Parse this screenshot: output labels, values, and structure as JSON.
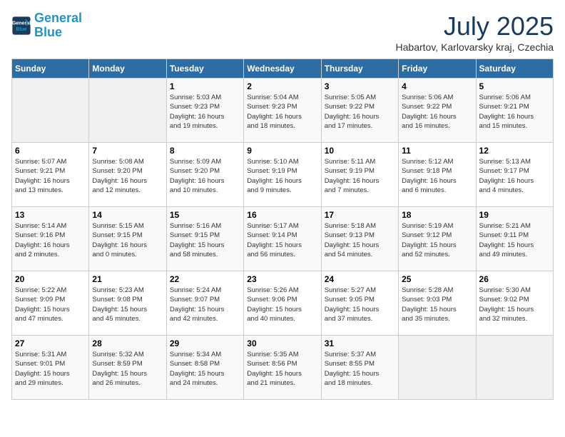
{
  "header": {
    "logo_line1": "General",
    "logo_line2": "Blue",
    "month": "July 2025",
    "location": "Habartov, Karlovarsky kraj, Czechia"
  },
  "weekdays": [
    "Sunday",
    "Monday",
    "Tuesday",
    "Wednesday",
    "Thursday",
    "Friday",
    "Saturday"
  ],
  "weeks": [
    [
      {
        "day": "",
        "detail": ""
      },
      {
        "day": "",
        "detail": ""
      },
      {
        "day": "1",
        "detail": "Sunrise: 5:03 AM\nSunset: 9:23 PM\nDaylight: 16 hours\nand 19 minutes."
      },
      {
        "day": "2",
        "detail": "Sunrise: 5:04 AM\nSunset: 9:23 PM\nDaylight: 16 hours\nand 18 minutes."
      },
      {
        "day": "3",
        "detail": "Sunrise: 5:05 AM\nSunset: 9:22 PM\nDaylight: 16 hours\nand 17 minutes."
      },
      {
        "day": "4",
        "detail": "Sunrise: 5:06 AM\nSunset: 9:22 PM\nDaylight: 16 hours\nand 16 minutes."
      },
      {
        "day": "5",
        "detail": "Sunrise: 5:06 AM\nSunset: 9:21 PM\nDaylight: 16 hours\nand 15 minutes."
      }
    ],
    [
      {
        "day": "6",
        "detail": "Sunrise: 5:07 AM\nSunset: 9:21 PM\nDaylight: 16 hours\nand 13 minutes."
      },
      {
        "day": "7",
        "detail": "Sunrise: 5:08 AM\nSunset: 9:20 PM\nDaylight: 16 hours\nand 12 minutes."
      },
      {
        "day": "8",
        "detail": "Sunrise: 5:09 AM\nSunset: 9:20 PM\nDaylight: 16 hours\nand 10 minutes."
      },
      {
        "day": "9",
        "detail": "Sunrise: 5:10 AM\nSunset: 9:19 PM\nDaylight: 16 hours\nand 9 minutes."
      },
      {
        "day": "10",
        "detail": "Sunrise: 5:11 AM\nSunset: 9:19 PM\nDaylight: 16 hours\nand 7 minutes."
      },
      {
        "day": "11",
        "detail": "Sunrise: 5:12 AM\nSunset: 9:18 PM\nDaylight: 16 hours\nand 6 minutes."
      },
      {
        "day": "12",
        "detail": "Sunrise: 5:13 AM\nSunset: 9:17 PM\nDaylight: 16 hours\nand 4 minutes."
      }
    ],
    [
      {
        "day": "13",
        "detail": "Sunrise: 5:14 AM\nSunset: 9:16 PM\nDaylight: 16 hours\nand 2 minutes."
      },
      {
        "day": "14",
        "detail": "Sunrise: 5:15 AM\nSunset: 9:15 PM\nDaylight: 16 hours\nand 0 minutes."
      },
      {
        "day": "15",
        "detail": "Sunrise: 5:16 AM\nSunset: 9:15 PM\nDaylight: 15 hours\nand 58 minutes."
      },
      {
        "day": "16",
        "detail": "Sunrise: 5:17 AM\nSunset: 9:14 PM\nDaylight: 15 hours\nand 56 minutes."
      },
      {
        "day": "17",
        "detail": "Sunrise: 5:18 AM\nSunset: 9:13 PM\nDaylight: 15 hours\nand 54 minutes."
      },
      {
        "day": "18",
        "detail": "Sunrise: 5:19 AM\nSunset: 9:12 PM\nDaylight: 15 hours\nand 52 minutes."
      },
      {
        "day": "19",
        "detail": "Sunrise: 5:21 AM\nSunset: 9:11 PM\nDaylight: 15 hours\nand 49 minutes."
      }
    ],
    [
      {
        "day": "20",
        "detail": "Sunrise: 5:22 AM\nSunset: 9:09 PM\nDaylight: 15 hours\nand 47 minutes."
      },
      {
        "day": "21",
        "detail": "Sunrise: 5:23 AM\nSunset: 9:08 PM\nDaylight: 15 hours\nand 45 minutes."
      },
      {
        "day": "22",
        "detail": "Sunrise: 5:24 AM\nSunset: 9:07 PM\nDaylight: 15 hours\nand 42 minutes."
      },
      {
        "day": "23",
        "detail": "Sunrise: 5:26 AM\nSunset: 9:06 PM\nDaylight: 15 hours\nand 40 minutes."
      },
      {
        "day": "24",
        "detail": "Sunrise: 5:27 AM\nSunset: 9:05 PM\nDaylight: 15 hours\nand 37 minutes."
      },
      {
        "day": "25",
        "detail": "Sunrise: 5:28 AM\nSunset: 9:03 PM\nDaylight: 15 hours\nand 35 minutes."
      },
      {
        "day": "26",
        "detail": "Sunrise: 5:30 AM\nSunset: 9:02 PM\nDaylight: 15 hours\nand 32 minutes."
      }
    ],
    [
      {
        "day": "27",
        "detail": "Sunrise: 5:31 AM\nSunset: 9:01 PM\nDaylight: 15 hours\nand 29 minutes."
      },
      {
        "day": "28",
        "detail": "Sunrise: 5:32 AM\nSunset: 8:59 PM\nDaylight: 15 hours\nand 26 minutes."
      },
      {
        "day": "29",
        "detail": "Sunrise: 5:34 AM\nSunset: 8:58 PM\nDaylight: 15 hours\nand 24 minutes."
      },
      {
        "day": "30",
        "detail": "Sunrise: 5:35 AM\nSunset: 8:56 PM\nDaylight: 15 hours\nand 21 minutes."
      },
      {
        "day": "31",
        "detail": "Sunrise: 5:37 AM\nSunset: 8:55 PM\nDaylight: 15 hours\nand 18 minutes."
      },
      {
        "day": "",
        "detail": ""
      },
      {
        "day": "",
        "detail": ""
      }
    ]
  ]
}
